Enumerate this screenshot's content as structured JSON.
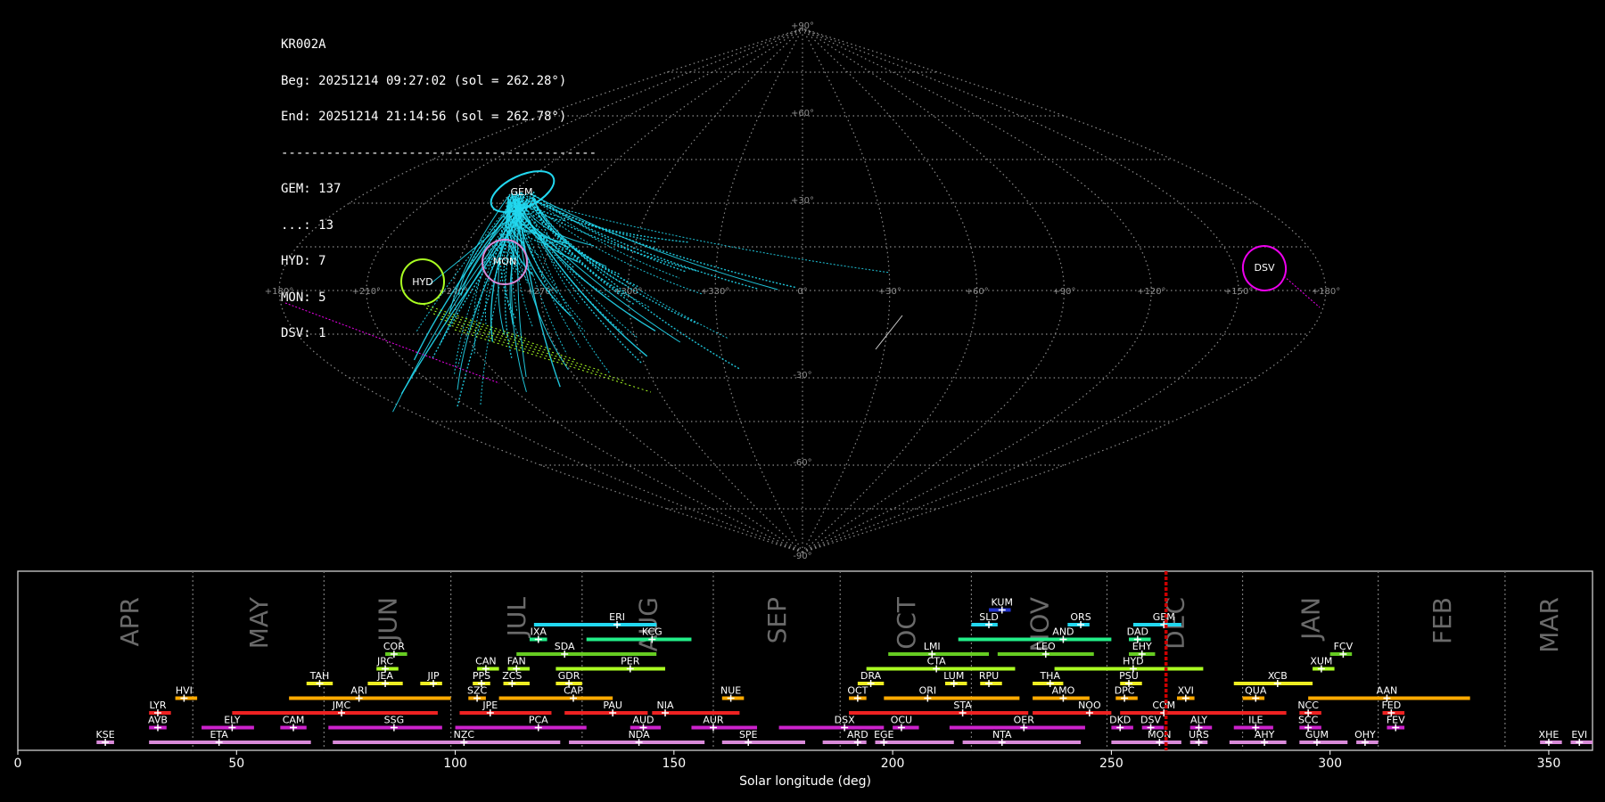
{
  "info": {
    "camera": "KR002A",
    "begin": "Beg: 20251214 09:27:02 (sol = 262.28°)",
    "end": "End: 20251214 21:14:56 (sol = 262.78°)",
    "separator": "------------------------------------------",
    "counts": [
      "GEM: 137",
      "...: 13",
      "HYD: 7",
      "MON: 5",
      "DSV: 1"
    ]
  },
  "colors": {
    "background": "#000000",
    "gem": "#22d8f0",
    "hyd": "#aaff22",
    "mon": "#d98ad9",
    "dsv": "#ee00ee",
    "sporadic": "#ffffff",
    "current_sol": "#cc0000"
  },
  "sky_map": {
    "projection": "sinusoidal",
    "lon_labels": [
      "+180°",
      "+150°",
      "+120°",
      "+90°",
      "+60°",
      "+30°",
      "0°",
      "+330°",
      "+300°",
      "+270°",
      "+240°",
      "+210°",
      "+180°"
    ],
    "lat_labels": [
      "+90°",
      "+60°",
      "+30°",
      "-30°",
      "-60°",
      "-90°"
    ],
    "radiant_labels": [
      {
        "name": "GEM",
        "color": "#22d8f0"
      },
      {
        "name": "MON",
        "color": "#d98ad9"
      },
      {
        "name": "HYD",
        "color": "#aaff22"
      },
      {
        "name": "DSV",
        "color": "#ee00ee"
      }
    ]
  },
  "chart_data": {
    "type": "bar",
    "xlabel": "Solar longitude (deg)",
    "xlim": [
      0,
      360
    ],
    "xticks": [
      0,
      50,
      100,
      150,
      200,
      250,
      300,
      350
    ],
    "current_sol": 262.5,
    "months": [
      {
        "name": "APR",
        "start": 11,
        "end": 40
      },
      {
        "name": "MAY",
        "start": 40,
        "end": 70
      },
      {
        "name": "JUN",
        "start": 70,
        "end": 99
      },
      {
        "name": "JUL",
        "start": 99,
        "end": 129
      },
      {
        "name": "AUG",
        "start": 129,
        "end": 159
      },
      {
        "name": "SEP",
        "start": 159,
        "end": 188
      },
      {
        "name": "OCT",
        "start": 188,
        "end": 218
      },
      {
        "name": "NOV",
        "start": 218,
        "end": 249
      },
      {
        "name": "DEC",
        "start": 249,
        "end": 280
      },
      {
        "name": "JAN",
        "start": 280,
        "end": 311
      },
      {
        "name": "FEB",
        "start": 311,
        "end": 340
      },
      {
        "name": "MAR",
        "start": 340,
        "end": 371
      }
    ],
    "showers": [
      {
        "name": "KUM",
        "row": 10,
        "start": 222,
        "end": 227,
        "peak": 225,
        "color": "#2233cc"
      },
      {
        "name": "ERI",
        "row": 9,
        "start": 118,
        "end": 146,
        "peak": 137,
        "color": "#22d8f0"
      },
      {
        "name": "SLD",
        "row": 9,
        "start": 218,
        "end": 224,
        "peak": 222,
        "color": "#22d8f0"
      },
      {
        "name": "ORS",
        "row": 9,
        "start": 240,
        "end": 245,
        "peak": 243,
        "color": "#22d8f0"
      },
      {
        "name": "GEM",
        "row": 9,
        "start": 255,
        "end": 266,
        "peak": 262,
        "color": "#22d8f0"
      },
      {
        "name": "IXA",
        "row": 8,
        "start": 117,
        "end": 121,
        "peak": 119,
        "color": "#22ee88"
      },
      {
        "name": "KCG",
        "row": 8,
        "start": 130,
        "end": 154,
        "peak": 145,
        "color": "#22ee88"
      },
      {
        "name": "AND",
        "row": 8,
        "start": 215,
        "end": 250,
        "peak": 239,
        "color": "#22ee88"
      },
      {
        "name": "DAD",
        "row": 8,
        "start": 254,
        "end": 259,
        "peak": 256,
        "color": "#22ee88"
      },
      {
        "name": "COR",
        "row": 7,
        "start": 84,
        "end": 89,
        "peak": 86,
        "color": "#66cc22"
      },
      {
        "name": "SDA",
        "row": 7,
        "start": 114,
        "end": 146,
        "peak": 125,
        "color": "#66cc22"
      },
      {
        "name": "LMI",
        "row": 7,
        "start": 199,
        "end": 222,
        "peak": 209,
        "color": "#66cc22"
      },
      {
        "name": "LEO",
        "row": 7,
        "start": 224,
        "end": 246,
        "peak": 235,
        "color": "#66cc22"
      },
      {
        "name": "EHY",
        "row": 7,
        "start": 254,
        "end": 260,
        "peak": 257,
        "color": "#66cc22"
      },
      {
        "name": "FCV",
        "row": 7,
        "start": 300,
        "end": 305,
        "peak": 303,
        "color": "#66cc22"
      },
      {
        "name": "JRC",
        "row": 6,
        "start": 82,
        "end": 87,
        "peak": 84,
        "color": "#aaff22"
      },
      {
        "name": "CAN",
        "row": 6,
        "start": 105,
        "end": 110,
        "peak": 107,
        "color": "#aaff22"
      },
      {
        "name": "FAN",
        "row": 6,
        "start": 112,
        "end": 117,
        "peak": 114,
        "color": "#aaff22"
      },
      {
        "name": "PER",
        "row": 6,
        "start": 123,
        "end": 148,
        "peak": 140,
        "color": "#aaff22"
      },
      {
        "name": "CTA",
        "row": 6,
        "start": 194,
        "end": 228,
        "peak": 210,
        "color": "#aaff22"
      },
      {
        "name": "HYD",
        "row": 6,
        "start": 237,
        "end": 271,
        "peak": 255,
        "color": "#aaff22"
      },
      {
        "name": "XUM",
        "row": 6,
        "start": 296,
        "end": 301,
        "peak": 298,
        "color": "#aaff22"
      },
      {
        "name": "TAH",
        "row": 5,
        "start": 66,
        "end": 72,
        "peak": 69,
        "color": "#eeee22"
      },
      {
        "name": "JEA",
        "row": 5,
        "start": 80,
        "end": 88,
        "peak": 84,
        "color": "#eeee22"
      },
      {
        "name": "JIP",
        "row": 5,
        "start": 92,
        "end": 97,
        "peak": 95,
        "color": "#eeee22"
      },
      {
        "name": "PPS",
        "row": 5,
        "start": 104,
        "end": 108,
        "peak": 106,
        "color": "#eeee22"
      },
      {
        "name": "ZCS",
        "row": 5,
        "start": 111,
        "end": 117,
        "peak": 113,
        "color": "#eeee22"
      },
      {
        "name": "GDR",
        "row": 5,
        "start": 123,
        "end": 129,
        "peak": 126,
        "color": "#eeee22"
      },
      {
        "name": "DRA",
        "row": 5,
        "start": 192,
        "end": 198,
        "peak": 195,
        "color": "#eeee22"
      },
      {
        "name": "LUM",
        "row": 5,
        "start": 212,
        "end": 217,
        "peak": 214,
        "color": "#eeee22"
      },
      {
        "name": "RPU",
        "row": 5,
        "start": 220,
        "end": 225,
        "peak": 222,
        "color": "#eeee22"
      },
      {
        "name": "THA",
        "row": 5,
        "start": 232,
        "end": 239,
        "peak": 236,
        "color": "#eeee22"
      },
      {
        "name": "PSU",
        "row": 5,
        "start": 252,
        "end": 257,
        "peak": 254,
        "color": "#eeee22"
      },
      {
        "name": "XCB",
        "row": 5,
        "start": 278,
        "end": 296,
        "peak": 288,
        "color": "#eeee22"
      },
      {
        "name": "HVI",
        "row": 4,
        "start": 36,
        "end": 41,
        "peak": 38,
        "color": "#ffaa00"
      },
      {
        "name": "ARI",
        "row": 4,
        "start": 62,
        "end": 99,
        "peak": 78,
        "color": "#ffaa00"
      },
      {
        "name": "SZC",
        "row": 4,
        "start": 103,
        "end": 107,
        "peak": 105,
        "color": "#ffaa00"
      },
      {
        "name": "CAP",
        "row": 4,
        "start": 110,
        "end": 136,
        "peak": 127,
        "color": "#ffaa00"
      },
      {
        "name": "NUE",
        "row": 4,
        "start": 161,
        "end": 166,
        "peak": 163,
        "color": "#ffaa00"
      },
      {
        "name": "OCT",
        "row": 4,
        "start": 190,
        "end": 194,
        "peak": 192,
        "color": "#ffaa00"
      },
      {
        "name": "ORI",
        "row": 4,
        "start": 198,
        "end": 229,
        "peak": 208,
        "color": "#ffaa00"
      },
      {
        "name": "AMO",
        "row": 4,
        "start": 232,
        "end": 245,
        "peak": 239,
        "color": "#ffaa00"
      },
      {
        "name": "DPC",
        "row": 4,
        "start": 251,
        "end": 256,
        "peak": 253,
        "color": "#ffaa00"
      },
      {
        "name": "XVI",
        "row": 4,
        "start": 265,
        "end": 269,
        "peak": 267,
        "color": "#ffaa00"
      },
      {
        "name": "QUA",
        "row": 4,
        "start": 280,
        "end": 285,
        "peak": 283,
        "color": "#ffaa00"
      },
      {
        "name": "AAN",
        "row": 4,
        "start": 295,
        "end": 332,
        "peak": 313,
        "color": "#ffaa00"
      },
      {
        "name": "LYR",
        "row": 3,
        "start": 30,
        "end": 35,
        "peak": 32,
        "color": "#ee2222"
      },
      {
        "name": "JMC",
        "row": 3,
        "start": 49,
        "end": 96,
        "peak": 74,
        "color": "#ee2222"
      },
      {
        "name": "JPE",
        "row": 3,
        "start": 101,
        "end": 122,
        "peak": 108,
        "color": "#ee2222"
      },
      {
        "name": "PAU",
        "row": 3,
        "start": 125,
        "end": 144,
        "peak": 136,
        "color": "#ee2222"
      },
      {
        "name": "NIA",
        "row": 3,
        "start": 145,
        "end": 165,
        "peak": 148,
        "color": "#ee2222"
      },
      {
        "name": "STA",
        "row": 3,
        "start": 190,
        "end": 231,
        "peak": 216,
        "color": "#ee2222"
      },
      {
        "name": "NOO",
        "row": 3,
        "start": 232,
        "end": 250,
        "peak": 245,
        "color": "#ee2222"
      },
      {
        "name": "COM",
        "row": 3,
        "start": 252,
        "end": 290,
        "peak": 262,
        "color": "#ee2222"
      },
      {
        "name": "NCC",
        "row": 3,
        "start": 293,
        "end": 298,
        "peak": 295,
        "color": "#ee2222"
      },
      {
        "name": "FED",
        "row": 3,
        "start": 312,
        "end": 317,
        "peak": 314,
        "color": "#ee2222"
      },
      {
        "name": "AVB",
        "row": 2,
        "start": 30,
        "end": 34,
        "peak": 32,
        "color": "#cc22cc"
      },
      {
        "name": "ELY",
        "row": 2,
        "start": 42,
        "end": 54,
        "peak": 49,
        "color": "#cc22cc"
      },
      {
        "name": "CAM",
        "row": 2,
        "start": 60,
        "end": 66,
        "peak": 63,
        "color": "#cc22cc"
      },
      {
        "name": "SSG",
        "row": 2,
        "start": 71,
        "end": 97,
        "peak": 86,
        "color": "#cc22cc"
      },
      {
        "name": "PCA",
        "row": 2,
        "start": 100,
        "end": 130,
        "peak": 119,
        "color": "#cc22cc"
      },
      {
        "name": "AUD",
        "row": 2,
        "start": 140,
        "end": 147,
        "peak": 143,
        "color": "#cc22cc"
      },
      {
        "name": "AUR",
        "row": 2,
        "start": 154,
        "end": 169,
        "peak": 159,
        "color": "#cc22cc"
      },
      {
        "name": "DSX",
        "row": 2,
        "start": 174,
        "end": 198,
        "peak": 189,
        "color": "#cc22cc"
      },
      {
        "name": "OCU",
        "row": 2,
        "start": 200,
        "end": 206,
        "peak": 202,
        "color": "#cc22cc"
      },
      {
        "name": "OER",
        "row": 2,
        "start": 213,
        "end": 244,
        "peak": 230,
        "color": "#cc22cc"
      },
      {
        "name": "DKD",
        "row": 2,
        "start": 250,
        "end": 255,
        "peak": 252,
        "color": "#cc22cc"
      },
      {
        "name": "DSV",
        "row": 2,
        "start": 257,
        "end": 262,
        "peak": 259,
        "color": "#cc22cc"
      },
      {
        "name": "ALY",
        "row": 2,
        "start": 268,
        "end": 273,
        "peak": 270,
        "color": "#cc22cc"
      },
      {
        "name": "ILE",
        "row": 2,
        "start": 278,
        "end": 287,
        "peak": 283,
        "color": "#cc22cc"
      },
      {
        "name": "SCC",
        "row": 2,
        "start": 293,
        "end": 298,
        "peak": 295,
        "color": "#cc22cc"
      },
      {
        "name": "FEV",
        "row": 2,
        "start": 313,
        "end": 317,
        "peak": 315,
        "color": "#cc22cc"
      },
      {
        "name": "KSE",
        "row": 1,
        "start": 18,
        "end": 22,
        "peak": 20,
        "color": "#d98ad9"
      },
      {
        "name": "ETA",
        "row": 1,
        "start": 30,
        "end": 67,
        "peak": 46,
        "color": "#d98ad9"
      },
      {
        "name": "NZC",
        "row": 1,
        "start": 72,
        "end": 124,
        "peak": 102,
        "color": "#d98ad9"
      },
      {
        "name": "NDA",
        "row": 1,
        "start": 126,
        "end": 157,
        "peak": 142,
        "color": "#d98ad9"
      },
      {
        "name": "SPE",
        "row": 1,
        "start": 161,
        "end": 180,
        "peak": 167,
        "color": "#d98ad9"
      },
      {
        "name": "ARD",
        "row": 1,
        "start": 184,
        "end": 194,
        "peak": 192,
        "color": "#d98ad9"
      },
      {
        "name": "EGE",
        "row": 1,
        "start": 196,
        "end": 214,
        "peak": 198,
        "color": "#d98ad9"
      },
      {
        "name": "NTA",
        "row": 1,
        "start": 216,
        "end": 243,
        "peak": 225,
        "color": "#d98ad9"
      },
      {
        "name": "MON",
        "row": 1,
        "start": 250,
        "end": 266,
        "peak": 261,
        "color": "#d98ad9"
      },
      {
        "name": "URS",
        "row": 1,
        "start": 268,
        "end": 272,
        "peak": 270,
        "color": "#d98ad9"
      },
      {
        "name": "AHY",
        "row": 1,
        "start": 277,
        "end": 290,
        "peak": 285,
        "color": "#d98ad9"
      },
      {
        "name": "GUM",
        "row": 1,
        "start": 293,
        "end": 304,
        "peak": 297,
        "color": "#d98ad9"
      },
      {
        "name": "OHY",
        "row": 1,
        "start": 306,
        "end": 311,
        "peak": 308,
        "color": "#d98ad9"
      },
      {
        "name": "XHE",
        "row": 1,
        "start": 348,
        "end": 353,
        "peak": 350,
        "color": "#d98ad9"
      },
      {
        "name": "EVI",
        "row": 1,
        "start": 355,
        "end": 360,
        "peak": 357,
        "color": "#d98ad9"
      }
    ]
  }
}
